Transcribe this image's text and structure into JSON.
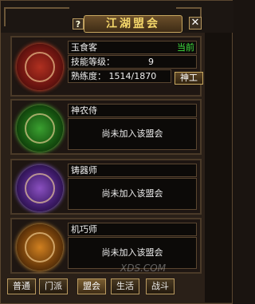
{
  "window": {
    "title": "江湖盟会",
    "help_icon": "question-mark-icon",
    "help_label": "?",
    "close_icon": "close-icon",
    "close_label": "✕"
  },
  "guilds": [
    {
      "name": "玉食客",
      "status_badge": "当前",
      "skill_level_label": "技能等级：",
      "skill_level_value": "9",
      "proficiency_label": "熟练度：",
      "proficiency_value": "1514/1870",
      "action_button": "神工",
      "icon": "chef-emblem-icon"
    },
    {
      "name": "神农侍",
      "status": "尚未加入该盟会",
      "icon": "herb-emblem-icon"
    },
    {
      "name": "铸器师",
      "status": "尚未加入该盟会",
      "icon": "smith-emblem-icon"
    },
    {
      "name": "机巧师",
      "status": "尚未加入该盟会",
      "icon": "mechanic-emblem-icon"
    }
  ],
  "tabs": [
    {
      "label": "普通"
    },
    {
      "label": "门派"
    },
    {
      "label": "盟会"
    },
    {
      "label": "生活"
    },
    {
      "label": "战斗"
    }
  ],
  "active_tab": "盟会",
  "watermark": "XDS.COM",
  "colors": {
    "title_text": "#f4d66a",
    "current_badge": "#3fe03f",
    "frame_border": "#5a4630"
  }
}
